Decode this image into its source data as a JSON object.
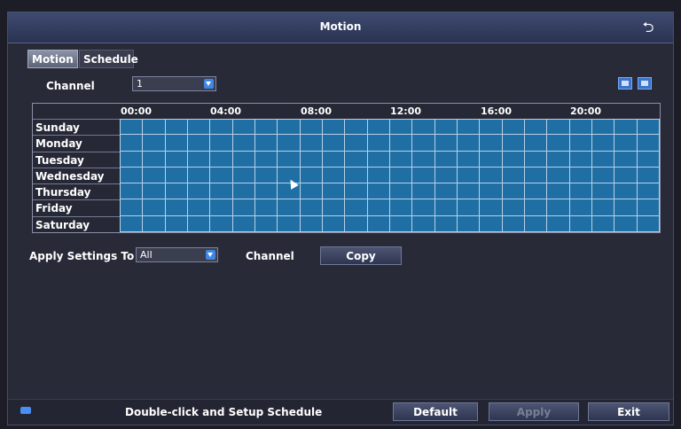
{
  "window": {
    "title": "Motion"
  },
  "tabs": [
    {
      "label": "Motion",
      "active": true
    },
    {
      "label": "Schedule",
      "active": false
    }
  ],
  "channel": {
    "label": "Channel",
    "value": "1"
  },
  "schedule": {
    "hours": [
      "00:00",
      "04:00",
      "08:00",
      "12:00",
      "16:00",
      "20:00"
    ],
    "days": [
      "Sunday",
      "Monday",
      "Tuesday",
      "Wednesday",
      "Thursday",
      "Friday",
      "Saturday"
    ],
    "slots_per_day": 24,
    "fill_color": "#1f6fa5"
  },
  "apply": {
    "label": "Apply Settings To",
    "value": "All",
    "channel_label": "Channel",
    "copy_label": "Copy"
  },
  "footer": {
    "hint": "Double-click and Setup Schedule",
    "default_label": "Default",
    "apply_label": "Apply",
    "exit_label": "Exit"
  }
}
